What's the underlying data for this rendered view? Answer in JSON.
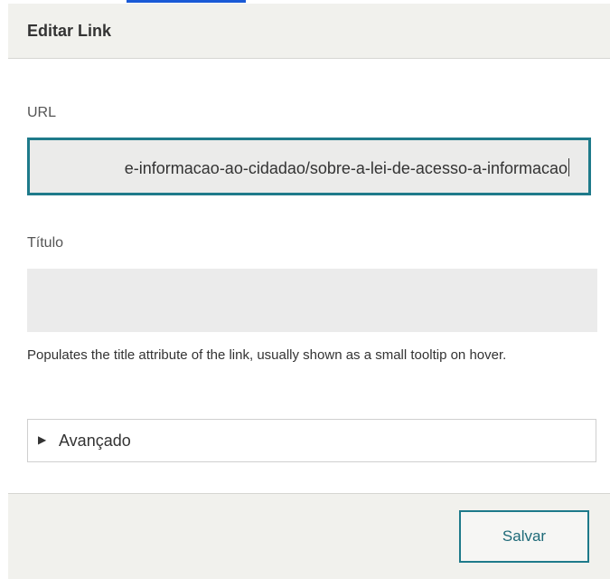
{
  "dialog": {
    "title": "Editar Link"
  },
  "url_field": {
    "label": "URL",
    "value": "e-informacao-ao-cidadao/sobre-a-lei-de-acesso-a-informacao"
  },
  "title_field": {
    "label": "Título",
    "value": "",
    "help": "Populates the title attribute of the link, usually shown as a small tooltip on hover."
  },
  "advanced": {
    "label": "Avançado",
    "icon": "triangle-right-icon"
  },
  "footer": {
    "save_label": "Salvar"
  },
  "colors": {
    "accent": "#1e7a8a",
    "header_bg": "#f1f1ed",
    "input_bg": "#ebebeb"
  }
}
